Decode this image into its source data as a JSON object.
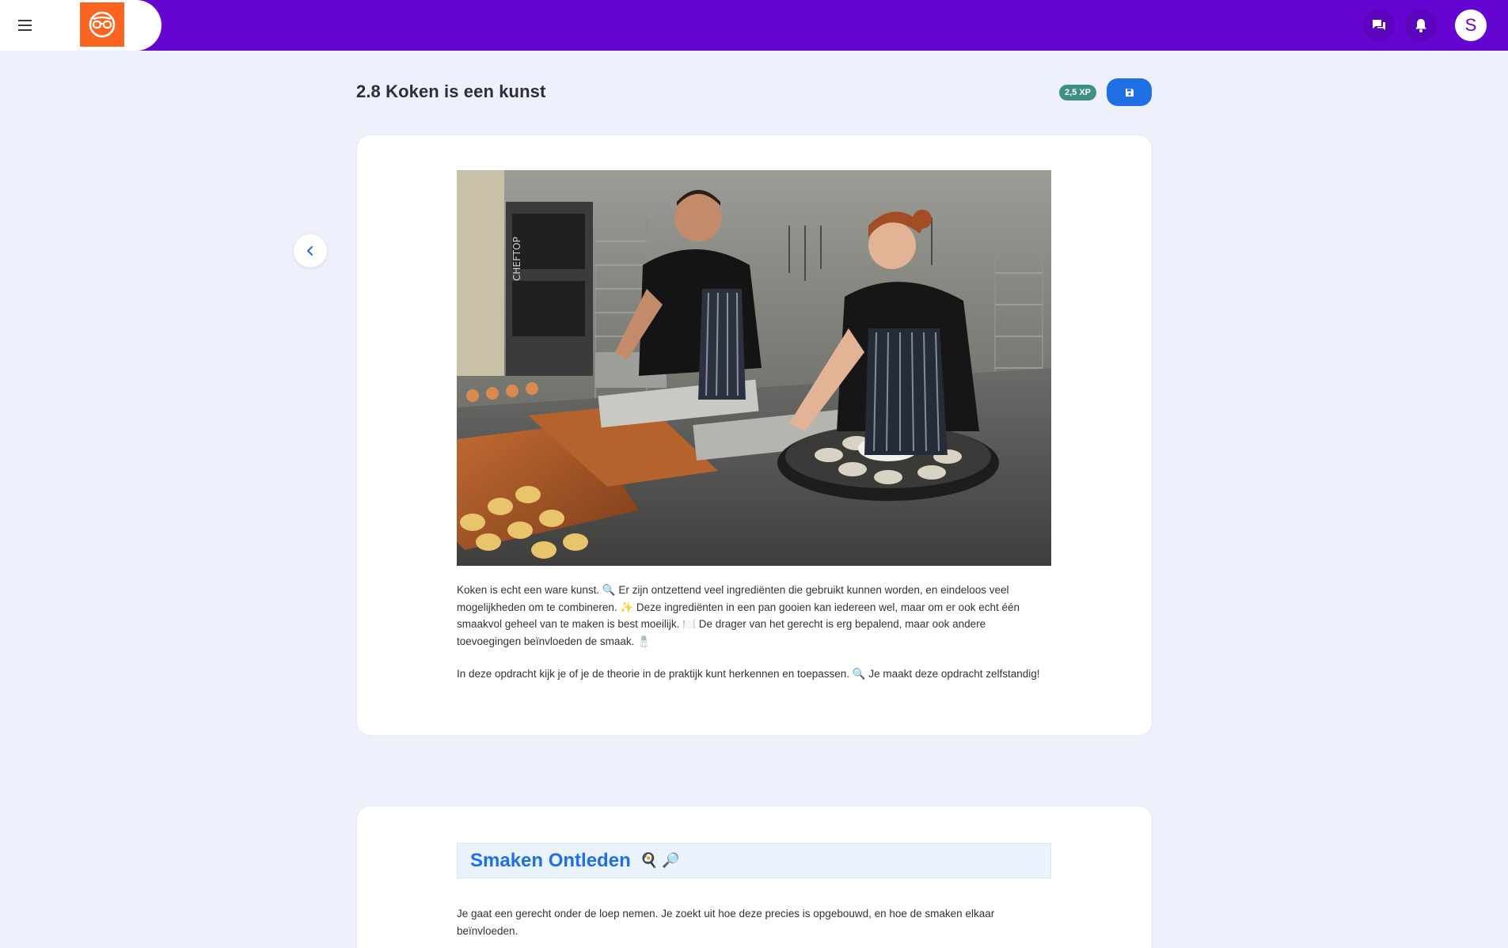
{
  "topbar": {
    "avatar_letter": "S",
    "icons": [
      "menu-icon",
      "logo-glasses-icon",
      "chat-icon",
      "bell-icon"
    ],
    "colors": {
      "bar": "#6405d1",
      "logo": "#fb6520"
    }
  },
  "page": {
    "title": "2.8 Koken is een kunst",
    "xp": "2,5 XP"
  },
  "intro": {
    "paragraph1": "Koken is echt een ware kunst. 🔍 Er zijn ontzettend veel ingrediënten die gebruikt kunnen worden, en eindeloos veel mogelijkheden om te combineren. ✨ Deze ingrediënten in een pan gooien kan iedereen wel, maar om er ook echt één smaakvol geheel van te maken is best moeilijk. 🍽️ De drager van het gerecht is erg bepalend, maar ook andere toevoegingen beïnvloeden de smaak. 🧂",
    "paragraph2": "In deze opdracht kijk je of je de theorie in de praktijk kunt herkennen en toepassen. 🔍 Je maakt deze opdracht zelfstandig!"
  },
  "section": {
    "heading": "Smaken Ontleden",
    "heading_emojis": "🍳 🔎",
    "paragraph": "Je gaat een gerecht onder de loep nemen. Je zoekt uit hoe deze precies is opgebouwd, en hoe de smaken elkaar beïnvloeden."
  }
}
